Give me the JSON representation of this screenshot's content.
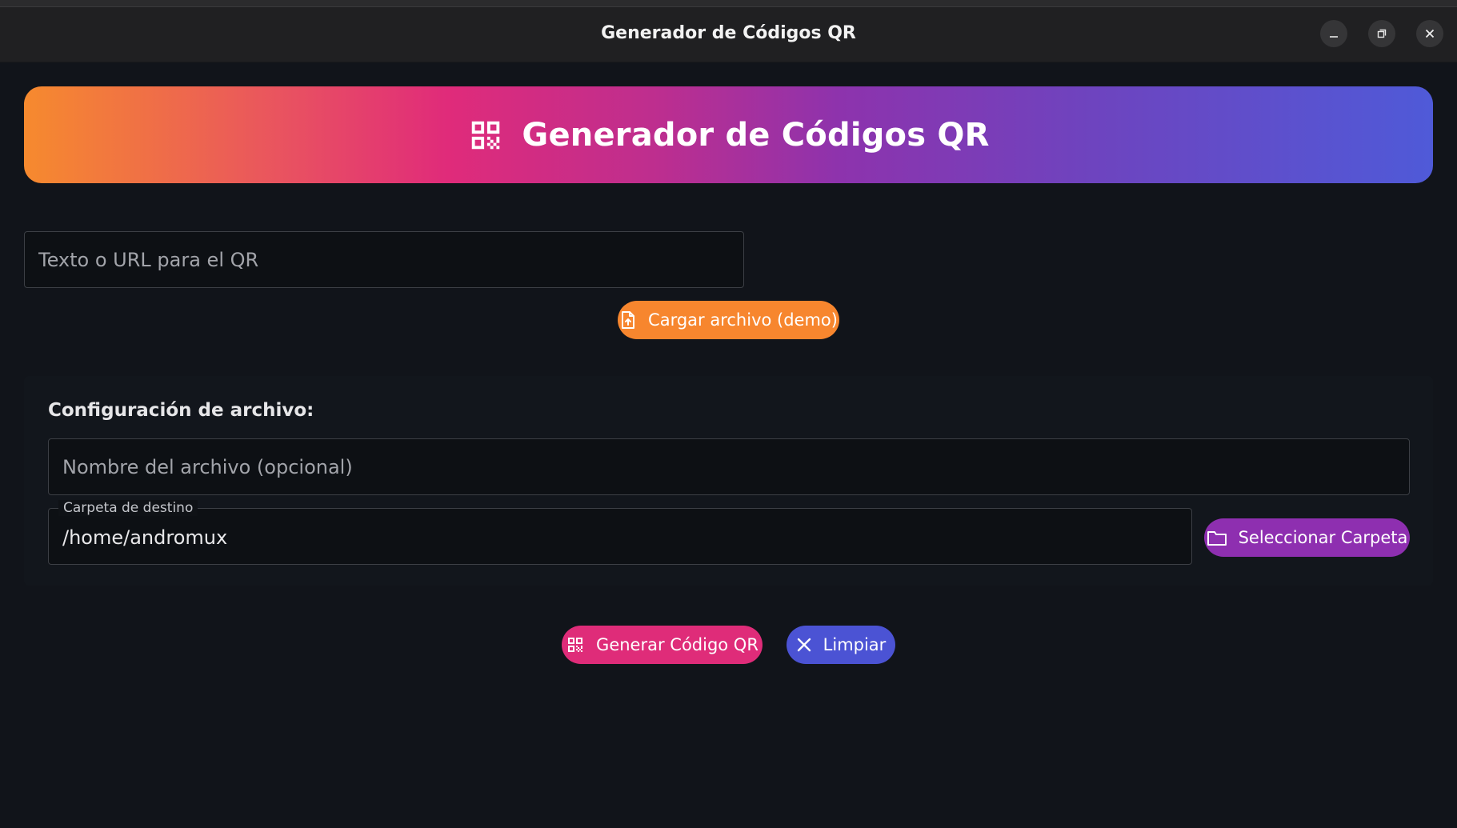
{
  "window": {
    "title": "Generador de Códigos QR"
  },
  "header": {
    "title": "Generador de Códigos QR",
    "icon": "qr-code-icon"
  },
  "input": {
    "placeholder": "Texto o URL para el QR",
    "value": ""
  },
  "upload_button": {
    "label": "Cargar archivo (demo)",
    "icon": "file-upload-icon"
  },
  "config": {
    "heading": "Configuración de archivo:",
    "filename": {
      "placeholder": "Nombre del archivo (opcional)",
      "value": ""
    },
    "folder": {
      "label": "Carpeta de destino",
      "value": "/home/andromux"
    },
    "select_folder_button": {
      "label": "Seleccionar Carpeta",
      "icon": "folder-icon"
    }
  },
  "actions": {
    "generate": {
      "label": "Generar Código QR",
      "icon": "qr-code-icon"
    },
    "clear": {
      "label": "Limpiar",
      "icon": "close-icon"
    }
  },
  "colors": {
    "background": "#11141a",
    "titlebar": "#202022",
    "orange": "#f7862e",
    "pink": "#df2c79",
    "purple": "#8e2fb0",
    "blue": "#4b53d4"
  }
}
